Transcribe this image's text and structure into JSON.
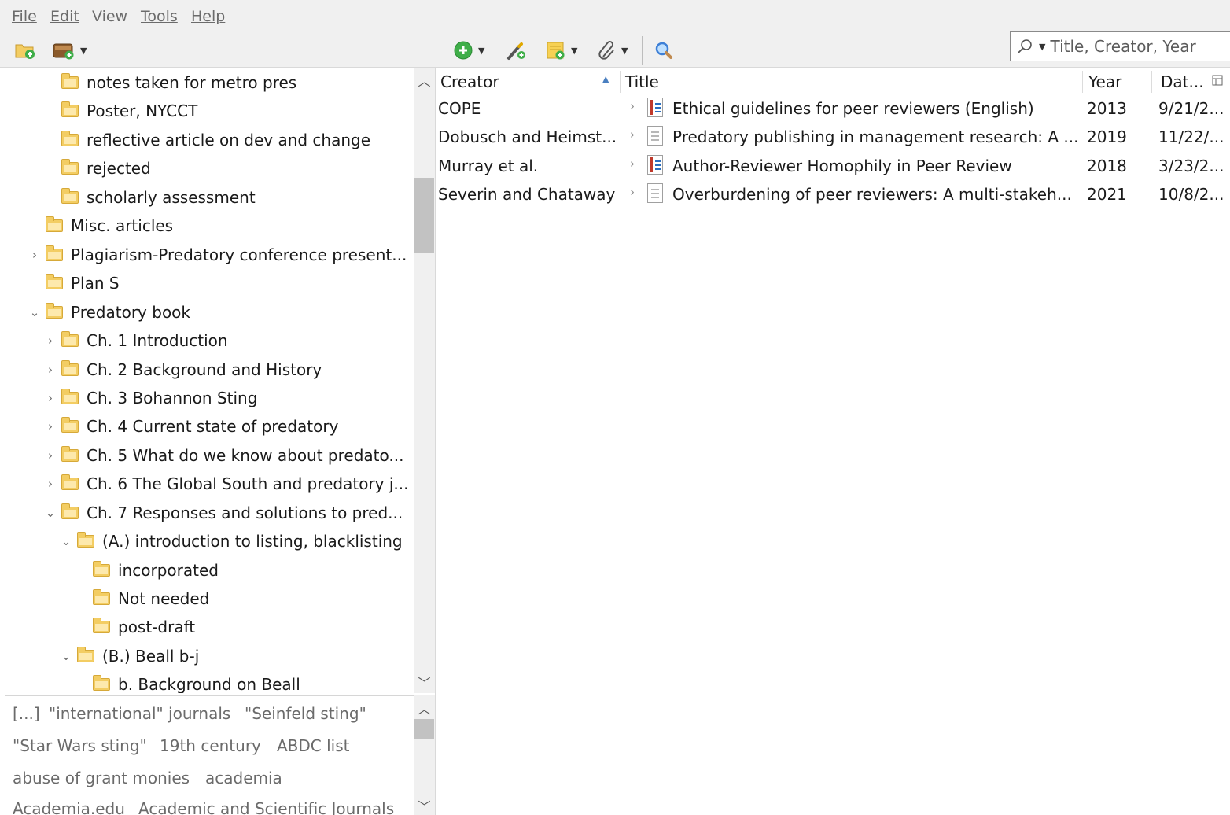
{
  "menu": [
    "File",
    "Edit",
    "View",
    "Tools",
    "Help"
  ],
  "search": {
    "placeholder": "Title, Creator, Year"
  },
  "collections": [
    {
      "label": "notes taken for metro pres",
      "twisty": ""
    },
    {
      "label": "Poster, NYCCT",
      "twisty": ""
    },
    {
      "label": "reflective article on dev and change",
      "twisty": ""
    },
    {
      "label": "rejected",
      "twisty": ""
    },
    {
      "label": "scholarly assessment",
      "twisty": ""
    },
    {
      "label": "Misc. articles",
      "twisty": ""
    },
    {
      "label": "Plagiarism-Predatory conference present...",
      "twisty": "›"
    },
    {
      "label": "Plan S",
      "twisty": ""
    },
    {
      "label": "Predatory book",
      "twisty": "⌄"
    },
    {
      "label": "Ch. 1 Introduction",
      "twisty": "›"
    },
    {
      "label": "Ch. 2 Background and History",
      "twisty": "›"
    },
    {
      "label": "Ch. 3 Bohannon Sting",
      "twisty": "›"
    },
    {
      "label": "Ch. 4 Current state of predatory",
      "twisty": "›"
    },
    {
      "label": "Ch. 5 What do we know about predato...",
      "twisty": "›"
    },
    {
      "label": "Ch. 6 The Global South and predatory j...",
      "twisty": "›"
    },
    {
      "label": "Ch. 7 Responses and solutions to pred...",
      "twisty": "⌄"
    },
    {
      "label": "(A.) introduction to listing, blacklisting",
      "twisty": "⌄"
    },
    {
      "label": "incorporated",
      "twisty": ""
    },
    {
      "label": "Not needed",
      "twisty": ""
    },
    {
      "label": "post-draft",
      "twisty": ""
    },
    {
      "label": "(B.) Beall b-j",
      "twisty": "⌄"
    },
    {
      "label": "b. Background on Beall",
      "twisty": ""
    }
  ],
  "tags": [
    "[...]",
    "\"international\" journals",
    "\"Seinfeld sting\"",
    "\"Star Wars sting\"",
    "19th century",
    "ABDC list",
    "abuse of grant monies",
    "academia",
    "Academia.edu",
    "Academic and Scientific Journals"
  ],
  "items": {
    "columns": {
      "creator": "Creator",
      "title": "Title",
      "year": "Year",
      "date": "Dat..."
    },
    "rows": [
      {
        "creator": "COPE",
        "title": "Ethical guidelines for peer reviewers (English)",
        "year": "2013",
        "date": "9/21/2...",
        "icon": "report-icon"
      },
      {
        "creator": "Dobusch and Heimst...",
        "title": "Predatory publishing in management research: A ...",
        "year": "2019",
        "date": "11/22/...",
        "icon": "document-icon"
      },
      {
        "creator": "Murray et al.",
        "title": "Author-Reviewer Homophily in Peer Review",
        "year": "2018",
        "date": "3/23/2...",
        "icon": "report-icon"
      },
      {
        "creator": "Severin and Chataway",
        "title": "Overburdening of peer reviewers: A multi-stakeh...",
        "year": "2021",
        "date": "10/8/2...",
        "icon": "document-icon"
      }
    ]
  },
  "colors": {
    "folder": "#f3cd63",
    "toolbar_bg": "#f0f0f0",
    "new_item_green": "#3fae49",
    "search_blue": "#3d7fd6"
  }
}
